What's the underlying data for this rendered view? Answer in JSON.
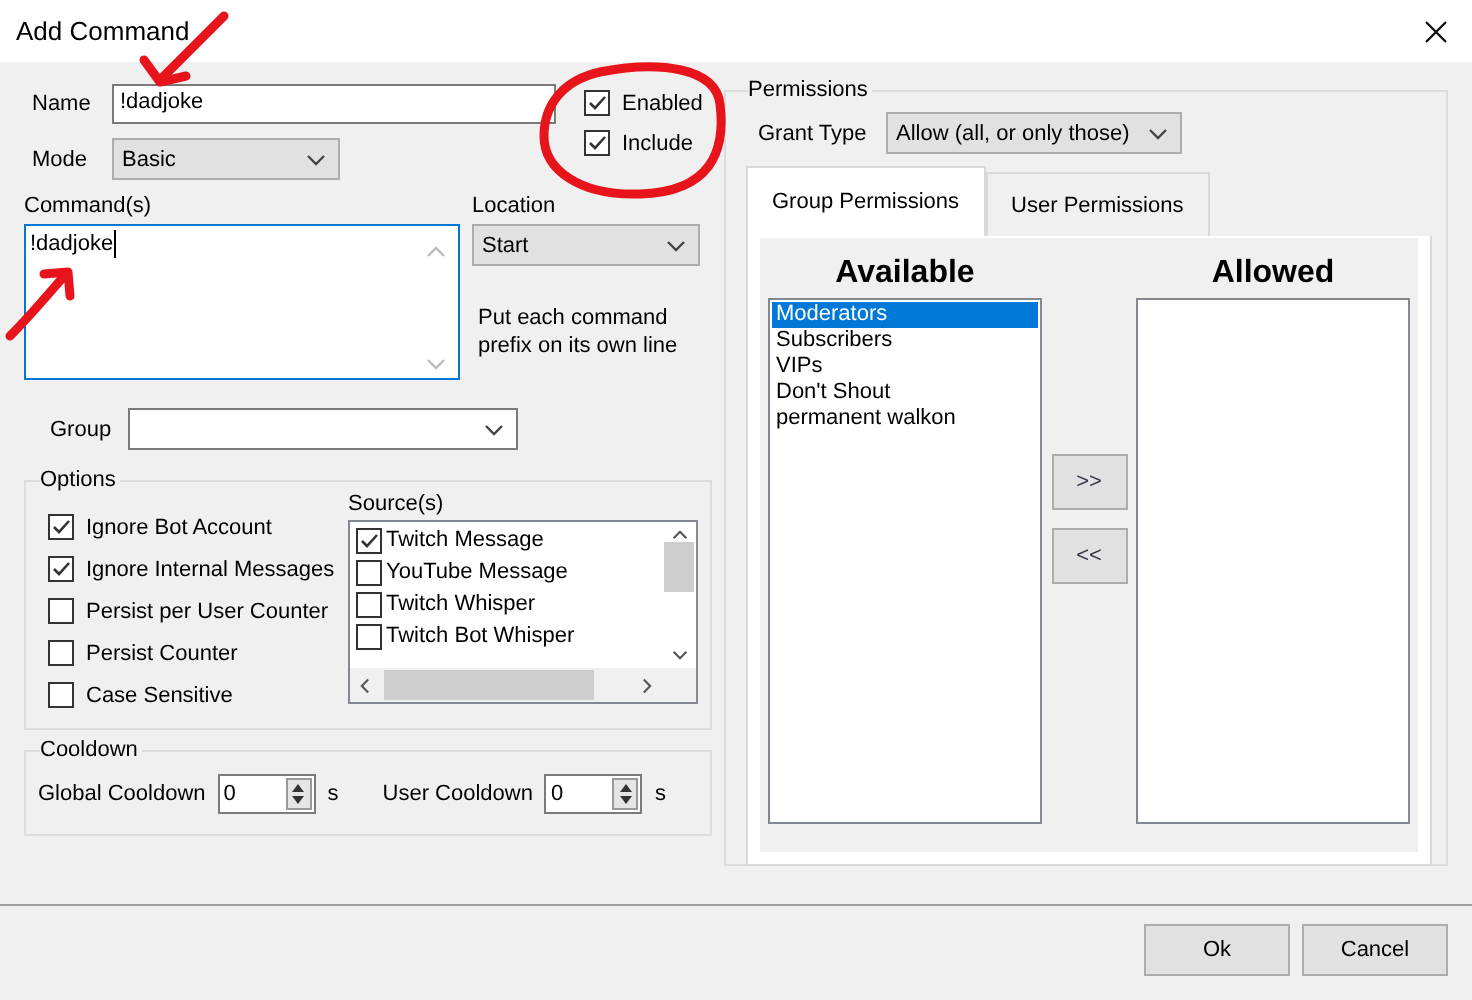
{
  "window": {
    "title": "Add Command"
  },
  "name_field": {
    "label": "Name",
    "value": "!dadjoke"
  },
  "flags": [
    {
      "label": "Enabled",
      "checked": true
    },
    {
      "label": "Include",
      "checked": true
    }
  ],
  "mode": {
    "label": "Mode",
    "value": "Basic"
  },
  "commands": {
    "label": "Command(s)",
    "value": "!dadjoke"
  },
  "location": {
    "label": "Location",
    "value": "Start",
    "hint": "Put each command prefix on its own line"
  },
  "group": {
    "label": "Group"
  },
  "options": {
    "title": "Options",
    "checkboxes": [
      {
        "label": "Ignore Bot Account",
        "checked": true
      },
      {
        "label": "Ignore Internal Messages",
        "checked": true
      },
      {
        "label": "Persist per User Counter",
        "checked": false
      },
      {
        "label": "Persist Counter",
        "checked": false
      },
      {
        "label": "Case Sensitive",
        "checked": false
      }
    ],
    "sources": {
      "label": "Source(s)",
      "items": [
        {
          "label": "Twitch Message",
          "checked": true
        },
        {
          "label": "YouTube Message",
          "checked": false
        },
        {
          "label": "Twitch Whisper",
          "checked": false
        },
        {
          "label": "Twitch Bot Whisper",
          "checked": false
        }
      ]
    }
  },
  "cooldown": {
    "title": "Cooldown",
    "fields": [
      {
        "label": "Global Cooldown",
        "value": "0",
        "unit": "s"
      },
      {
        "label": "User Cooldown",
        "value": "0",
        "unit": "s"
      }
    ]
  },
  "permissions": {
    "title": "Permissions",
    "grant_type": {
      "label": "Grant Type",
      "value": "Allow (all, or only those)"
    },
    "tabs": [
      {
        "label": "Group Permissions",
        "selected": true
      },
      {
        "label": "User Permissions",
        "selected": false
      }
    ],
    "available": {
      "title": "Available",
      "items": [
        {
          "label": "Moderators",
          "selected": true
        },
        {
          "label": "Subscribers",
          "selected": false
        },
        {
          "label": "VIPs",
          "selected": false
        },
        {
          "label": "Don't Shout",
          "selected": false
        },
        {
          "label": "permanent walkon",
          "selected": false
        }
      ]
    },
    "allowed": {
      "title": "Allowed"
    },
    "move_buttons": [
      ">>",
      "<<"
    ]
  },
  "buttons": [
    "Ok",
    "Cancel"
  ],
  "annotations": [
    {
      "kind": "arrow"
    },
    {
      "kind": "circle"
    },
    {
      "kind": "arrow"
    }
  ]
}
